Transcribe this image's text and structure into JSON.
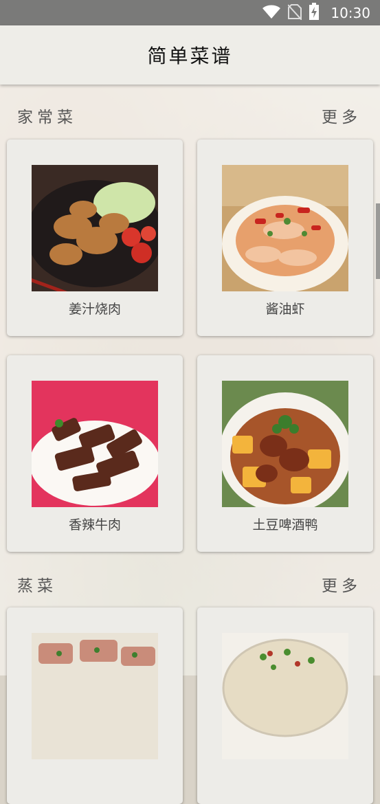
{
  "status_bar": {
    "time": "10:30",
    "icons": [
      "wifi-icon",
      "no-sim-icon",
      "battery-charging-icon"
    ]
  },
  "app_bar": {
    "title": "简单菜谱"
  },
  "sections": [
    {
      "title": "家常菜",
      "more_label": "更多",
      "dishes": [
        {
          "name": "姜汁烧肉",
          "image": "ginger-pork-image"
        },
        {
          "name": "酱油虾",
          "image": "soy-shrimp-image"
        },
        {
          "name": "香辣牛肉",
          "image": "spicy-beef-image"
        },
        {
          "name": "土豆啤酒鸭",
          "image": "potato-beer-duck-image"
        }
      ]
    },
    {
      "title": "蒸菜",
      "more_label": "更多",
      "dishes": [
        {
          "name": "",
          "image": "steamed-pork-image"
        },
        {
          "name": "",
          "image": "steamed-egg-image"
        }
      ]
    }
  ],
  "colors": {
    "status_bar": "#7a7a79",
    "app_bar": "#eeede8",
    "card": "#edece8",
    "text_secondary": "#555555"
  }
}
